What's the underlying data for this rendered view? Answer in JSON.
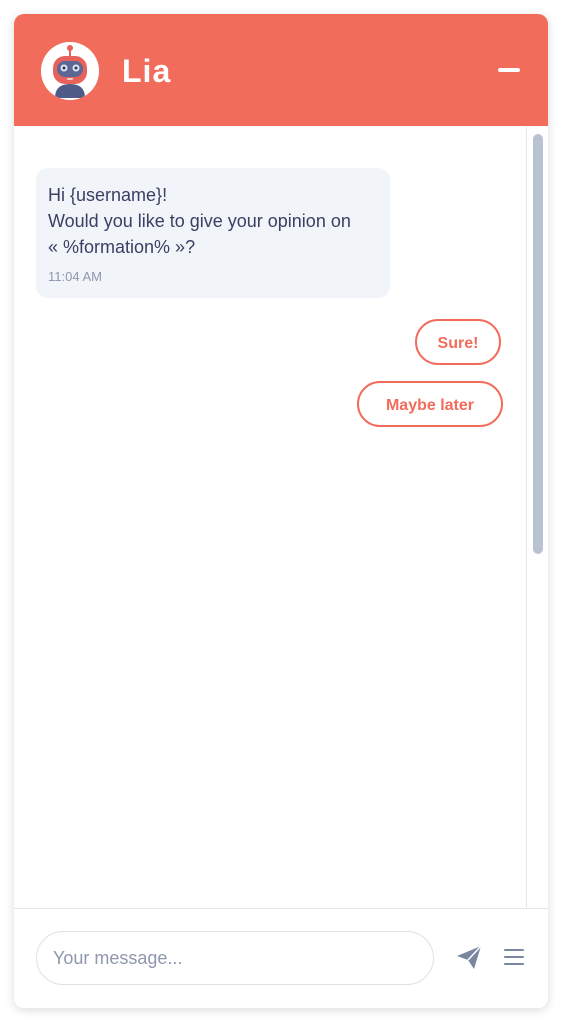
{
  "header": {
    "bot_name": "Lia",
    "avatar_icon": "robot-icon",
    "minimize_icon": "minimize-icon",
    "background_color": "#f26c5c"
  },
  "messages": [
    {
      "lines": [
        "Hi {username}!",
        "Would you like to give your opinion on",
        "« %formation% »?"
      ],
      "time": "11:04 AM"
    }
  ],
  "quick_replies": [
    "Sure!",
    "Maybe later"
  ],
  "composer": {
    "placeholder": "Your message...",
    "value": "",
    "send_icon": "send-icon",
    "menu_icon": "menu-icon"
  },
  "colors": {
    "accent": "#f26c5c",
    "bubble_bg": "#f1f4f9",
    "text": "#3a3f63",
    "muted": "#8e97ad"
  }
}
